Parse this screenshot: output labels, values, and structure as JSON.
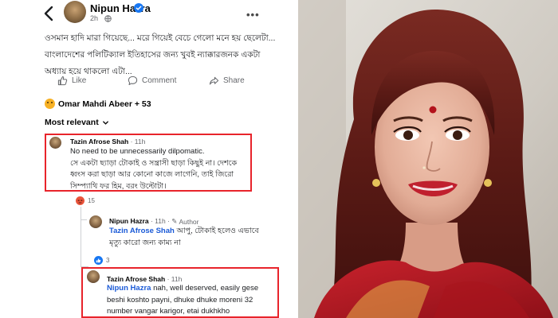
{
  "post": {
    "author": "Nipun Hazra",
    "time": "2h",
    "text": "ওসমান হাদি মারা গিয়েছে... মরে গিয়েই বেচে গেলো মনে হয় ছেলেটা... বাংলাদেশের পলিটিক্যাল ইতিহাসের জন্য খুবই ন্যাক্কারজনক একটা অধ্যায় হয়ে থাকলো এটা...",
    "actions": {
      "like": "Like",
      "comment": "Comment",
      "share": "Share"
    },
    "reactions_text": "Omar Mahdi Abeer + 53",
    "sort_label": "Most relevant"
  },
  "comments": [
    {
      "author": "Tazin Afrose Shah",
      "time": "11h",
      "text_line1": "No need to be unnecessarily dilpomatic.",
      "text_bn": "সে একটা ছ্যাড়া টোকাই ও সন্ত্রাসী ছাড়া কিছুই না। দেশকে ধ্বংস করা ছাড়া আর কোনো কাজে লাগেনি, তাই জিরো সিম্প্যাথি ফর হিম, বরং উল্টোটা।",
      "reaction_count": "15"
    },
    {
      "author": "Nipun Hazra",
      "time": "11h",
      "badge": "Author",
      "mention": "Tazin Afrose Shah",
      "text": "আপু, টোকাই হলেও এভাবে মৃত্যু কারো জন্য কাম্য না",
      "reaction_count": "3"
    },
    {
      "author": "Tazin Afrose Shah",
      "time": "11h",
      "mention": "Nipun Hazra",
      "text": "nah, well deserved, easily gese beshi koshto payni, dhuke dhuke moreni 32 number vangar karigor, etai dukhkho"
    }
  ],
  "colors": {
    "highlight": "#e8242b",
    "mention": "#1a5ad7",
    "verified": "#1877f2",
    "muted": "#65676b"
  },
  "icons": [
    "back-arrow-icon",
    "verified-icon",
    "globe-icon",
    "more-icon",
    "like-icon",
    "comment-icon",
    "share-icon",
    "angry-reaction-icon",
    "like-reaction-icon",
    "chevron-down-icon"
  ]
}
